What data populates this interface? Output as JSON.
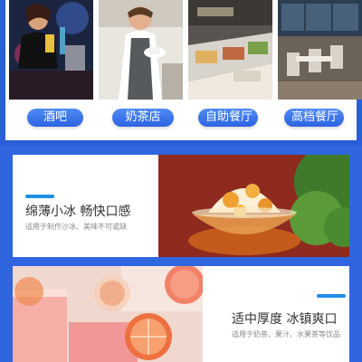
{
  "venues": [
    {
      "label": "酒吧",
      "icon": "bar-photo"
    },
    {
      "label": "奶茶店",
      "icon": "milk-tea-shop-photo"
    },
    {
      "label": "自助餐厅",
      "icon": "buffet-photo"
    },
    {
      "label": "高档餐厅",
      "icon": "fine-dining-photo"
    }
  ],
  "features": [
    {
      "title": "绵薄小冰 畅快口感",
      "subtitle": "适用于制作沙冰、美味不可或缺",
      "image": "shaved-ice-dessert-photo"
    },
    {
      "title": "适中厚度 冰镇爽口",
      "subtitle": "适用于奶茶、果汁、水果茶等饮品",
      "image": "grapefruit-drink-photo"
    }
  ],
  "colors": {
    "brand_blue": "#2f66e0",
    "accent": "#1f8fe3"
  }
}
